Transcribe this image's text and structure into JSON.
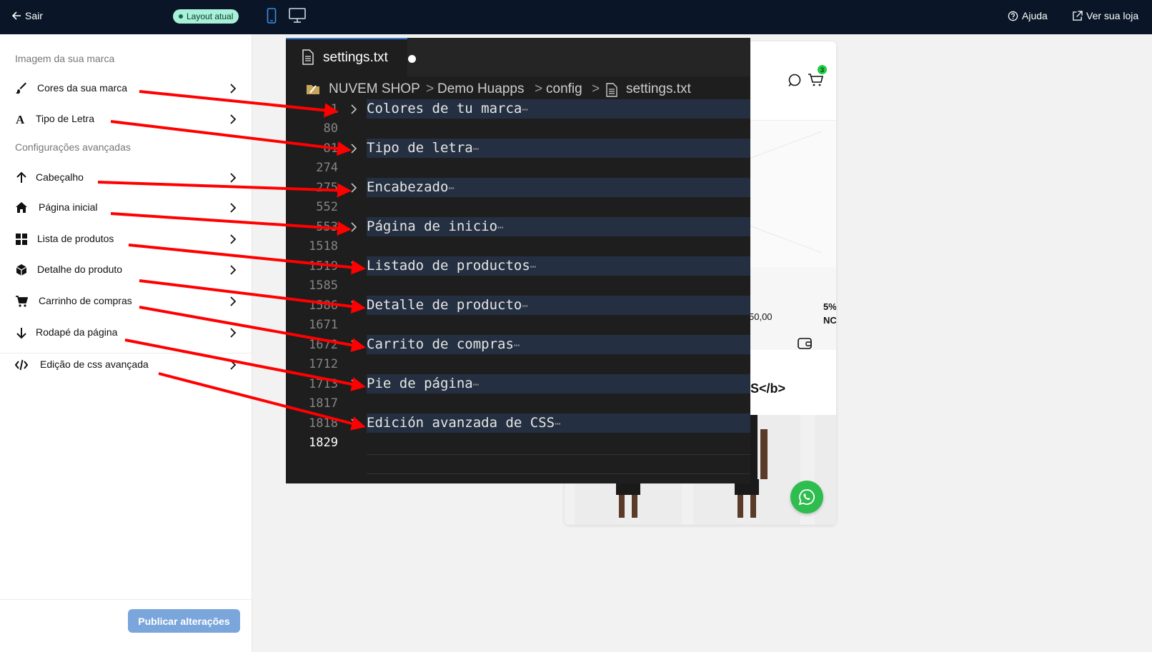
{
  "topbar": {
    "back_label": "Sair",
    "layout_badge": "Layout atual",
    "help_label": "Ajuda",
    "visit_label": "Ver sua loja",
    "active_device_color": "#3a8ee6"
  },
  "sidebar": {
    "section_brand": "Imagem da sua marca",
    "section_advanced": "Configurações avançadas",
    "items": [
      {
        "label": "Cores da sua marca",
        "icon": "brush-icon"
      },
      {
        "label": "Tipo de Letra",
        "icon": "font-icon"
      },
      {
        "label": "Cabeçalho",
        "icon": "arrow-up-icon"
      },
      {
        "label": "Página inicial",
        "icon": "home-icon"
      },
      {
        "label": "Lista de produtos",
        "icon": "grid-icon"
      },
      {
        "label": "Detalhe do produto",
        "icon": "box-icon"
      },
      {
        "label": "Carrinho de compras",
        "icon": "cart-icon"
      },
      {
        "label": "Rodapé da página",
        "icon": "arrow-down-icon"
      },
      {
        "label": "Edição de css avançada",
        "icon": "code-icon"
      }
    ],
    "publish_label": "Publicar alterações"
  },
  "preview": {
    "cart_count": "3",
    "price_fragment": "50,00",
    "discount_fragment": "5%",
    "discount_sub": "NC",
    "title_fragment": "S</b>"
  },
  "editor": {
    "tab_name": "settings.txt",
    "breadcrumb": [
      "NUVEM SHOP",
      "Demo Huapps",
      "config",
      "settings.txt"
    ],
    "lines": [
      "1",
      "80",
      "81",
      "274",
      "275",
      "552",
      "553",
      "1518",
      "1519",
      "1585",
      "1586",
      "1671",
      "1672",
      "1712",
      "1713",
      "1817",
      "1818",
      "1829"
    ],
    "folds": [
      "Colores de tu marca",
      "Tipo de letra",
      "Encabezado",
      "Página de inicio",
      "Listado de productos",
      "Detalle de producto",
      "Carrito de compras",
      "Pie de página",
      "Edición avanzada de CSS"
    ],
    "fold_marker": "⋯",
    "arrow_color": "#ff0000"
  }
}
